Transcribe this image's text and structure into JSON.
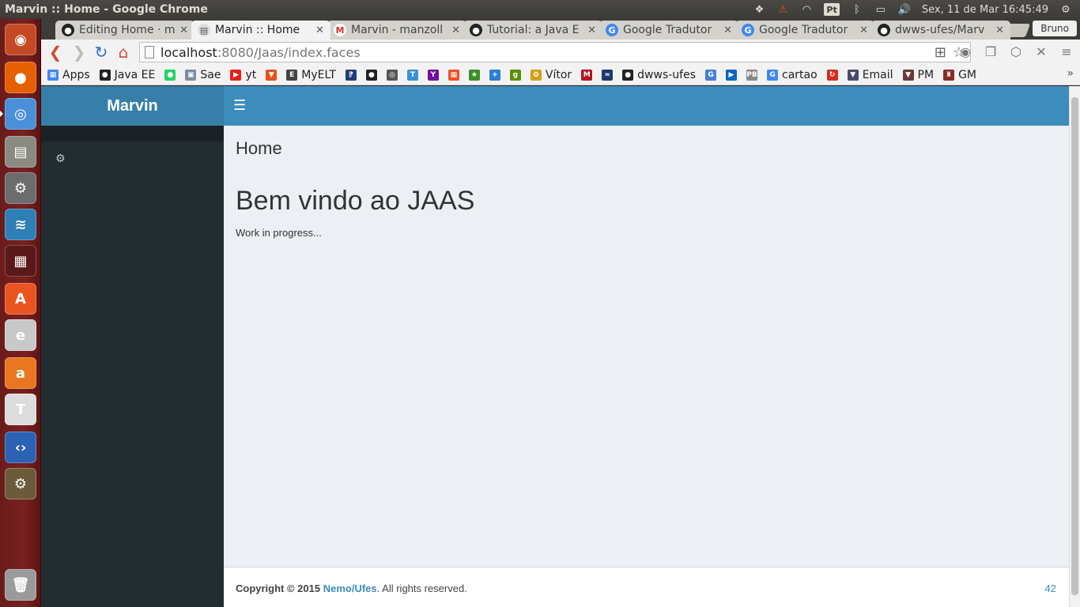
{
  "os": {
    "window_title": "Marvin :: Home - Google Chrome",
    "clock": "Sex, 11 de Mar 16:45:49",
    "pt_indicator": "Pt",
    "user": "Bruno",
    "launcher": [
      {
        "name": "ubuntu-dash-icon",
        "color": "#c44a26",
        "glyph": "◉"
      },
      {
        "name": "firefox-icon",
        "color": "#e66000",
        "glyph": "●"
      },
      {
        "name": "chrome-icon",
        "color": "#4a90d9",
        "glyph": "◎"
      },
      {
        "name": "files-icon",
        "color": "#8a8a80",
        "glyph": "▤"
      },
      {
        "name": "system-settings-icon",
        "color": "#6c6c6c",
        "glyph": "⚙"
      },
      {
        "name": "mysql-workbench-icon",
        "color": "#2e7fb5",
        "glyph": "≋"
      },
      {
        "name": "workspace-switcher-icon",
        "color": "#5a1818",
        "glyph": "▦"
      },
      {
        "name": "software-center-icon",
        "color": "#e95420",
        "glyph": "A"
      },
      {
        "name": "text-editor-icon",
        "color": "#c8c8c8",
        "glyph": "e"
      },
      {
        "name": "libreoffice-icon",
        "color": "#e8771f",
        "glyph": "a"
      },
      {
        "name": "texmaker-icon",
        "color": "#dcdcdc",
        "glyph": "T"
      },
      {
        "name": "code-editor-icon",
        "color": "#2c62b4",
        "glyph": "‹›"
      },
      {
        "name": "java-ee-ide-icon",
        "color": "#6b5b3a",
        "glyph": "⚙"
      },
      {
        "name": "trash-icon",
        "color": "#9a9a9a",
        "glyph": "🗑"
      }
    ]
  },
  "browser": {
    "tabs": [
      {
        "title": "Editing Home · m",
        "fav": "github",
        "active": false
      },
      {
        "title": "Marvin :: Home",
        "fav": "page",
        "active": true
      },
      {
        "title": "Marvin - manzoll",
        "fav": "gmail",
        "active": false
      },
      {
        "title": "Tutorial: a Java E",
        "fav": "github",
        "active": false
      },
      {
        "title": "Google Tradutor",
        "fav": "translate",
        "active": false
      },
      {
        "title": "Google Tradutor",
        "fav": "translate",
        "active": false
      },
      {
        "title": "dwws-ufes/Marv",
        "fav": "github",
        "active": false
      }
    ],
    "url_host": "localhost",
    "url_path": ":8080/Jaas/index.faces",
    "bookmarks": [
      {
        "label": "Apps",
        "color": "#4285f4",
        "glyph": "▦"
      },
      {
        "label": "Java EE",
        "color": "#222",
        "glyph": "●"
      },
      {
        "label": "",
        "color": "#25d366",
        "glyph": "●"
      },
      {
        "label": "Sae",
        "color": "#7a8ca0",
        "glyph": "▣"
      },
      {
        "label": "yt",
        "color": "#e62117",
        "glyph": "▶"
      },
      {
        "label": "",
        "color": "#e94e1b",
        "glyph": "▼"
      },
      {
        "label": "MyELT",
        "color": "#444",
        "glyph": "E"
      },
      {
        "label": "",
        "color": "#1f3d7a",
        "glyph": "⁋"
      },
      {
        "label": "",
        "color": "#222",
        "glyph": "●"
      },
      {
        "label": "",
        "color": "#555",
        "glyph": "◎"
      },
      {
        "label": "",
        "color": "#3a8fd6",
        "glyph": "T"
      },
      {
        "label": "",
        "color": "#720e9e",
        "glyph": "Y"
      },
      {
        "label": "",
        "color": "#f25022",
        "glyph": "▦"
      },
      {
        "label": "",
        "color": "#3a8f2a",
        "glyph": "★"
      },
      {
        "label": "",
        "color": "#2b7ed0",
        "glyph": "+"
      },
      {
        "label": "",
        "color": "#5a8f00",
        "glyph": "g"
      },
      {
        "label": "Vítor",
        "color": "#d4a017",
        "glyph": "✿"
      },
      {
        "label": "",
        "color": "#b0171f",
        "glyph": "M"
      },
      {
        "label": "",
        "color": "#1a3a6a",
        "glyph": "≈"
      },
      {
        "label": "dwws-ufes",
        "color": "#222",
        "glyph": "●"
      },
      {
        "label": "",
        "color": "#4a7fd6",
        "glyph": "G"
      },
      {
        "label": "",
        "color": "#0a66c2",
        "glyph": "▶"
      },
      {
        "label": "",
        "color": "#888",
        "glyph": "PB"
      },
      {
        "label": "cartao",
        "color": "#4285f4",
        "glyph": "G"
      },
      {
        "label": "",
        "color": "#d62d20",
        "glyph": "↻"
      },
      {
        "label": "Email",
        "color": "#4a4a6a",
        "glyph": "▼"
      },
      {
        "label": "PM",
        "color": "#6a3a3a",
        "glyph": "▼"
      },
      {
        "label": "GM",
        "color": "#8a2a2a",
        "glyph": "♜"
      }
    ]
  },
  "app": {
    "brand": "Marvin",
    "menu_icon": "bars-icon",
    "sidebar_icon": "cogs-icon",
    "breadcrumb_title": "Home",
    "welcome_heading": "Bem vindo ao JAAS",
    "subtitle": "Work in progress...",
    "footer": {
      "copyright_prefix": "Copyright © 2015",
      "link_text": "Nemo/Ufes",
      "suffix": ". All rights reserved.",
      "version": "42"
    },
    "colors": {
      "header": "#3c8dbc",
      "logo": "#367fa9",
      "sidebar": "#222d32",
      "content_bg": "#ecf0f5"
    }
  }
}
